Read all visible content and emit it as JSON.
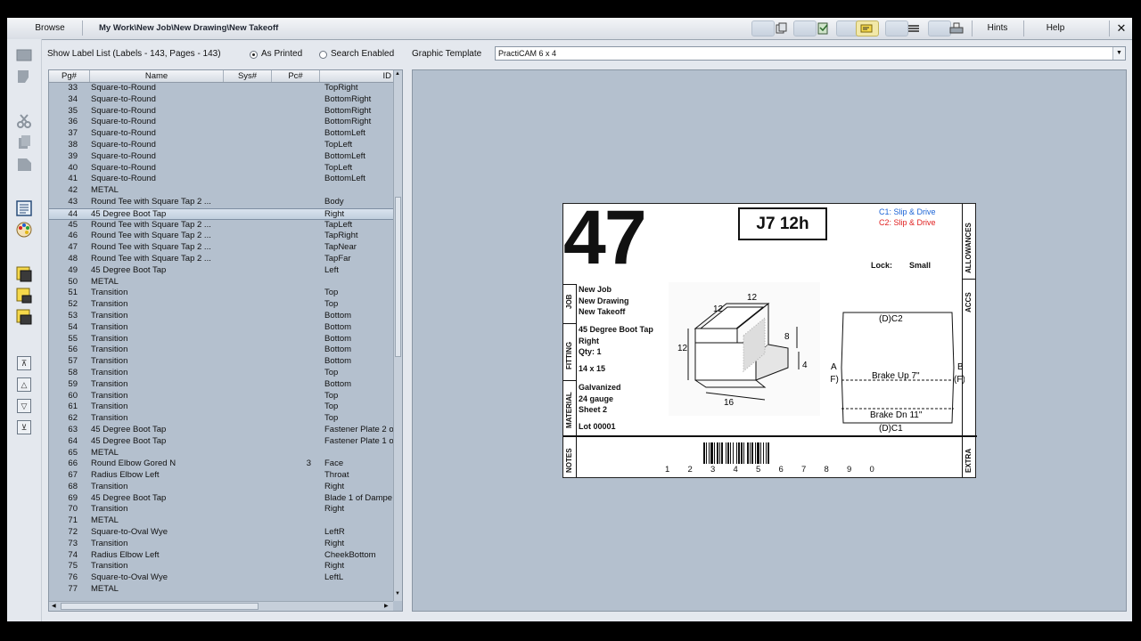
{
  "topbar": {
    "browse": "Browse",
    "path": "My Work\\New Job\\New Drawing\\New Takeoff",
    "hints": "Hints",
    "help": "Help",
    "close": "✕"
  },
  "controls": {
    "show_label_list": "Show Label List (Labels - 143, Pages - 143)",
    "as_printed": "As Printed",
    "search_enabled": "Search Enabled",
    "graphic_template_label": "Graphic Template",
    "graphic_template_value": "PractiCAM 6 x 4"
  },
  "list": {
    "columns": [
      "Pg#",
      "Name",
      "Sys#",
      "Pc#",
      "ID"
    ],
    "selected_pg": "44",
    "rows": [
      {
        "pg": "33",
        "name": "Square-to-Round",
        "pc": "",
        "id": "TopRight"
      },
      {
        "pg": "34",
        "name": "Square-to-Round",
        "pc": "",
        "id": "BottomRight"
      },
      {
        "pg": "35",
        "name": "Square-to-Round",
        "pc": "",
        "id": "BottomRight"
      },
      {
        "pg": "36",
        "name": "Square-to-Round",
        "pc": "",
        "id": "BottomRight"
      },
      {
        "pg": "37",
        "name": "Square-to-Round",
        "pc": "",
        "id": "BottomLeft"
      },
      {
        "pg": "38",
        "name": "Square-to-Round",
        "pc": "",
        "id": "TopLeft"
      },
      {
        "pg": "39",
        "name": "Square-to-Round",
        "pc": "",
        "id": "BottomLeft"
      },
      {
        "pg": "40",
        "name": "Square-to-Round",
        "pc": "",
        "id": "TopLeft"
      },
      {
        "pg": "41",
        "name": "Square-to-Round",
        "pc": "",
        "id": "BottomLeft"
      },
      {
        "pg": "42",
        "name": "METAL",
        "pc": "",
        "id": ""
      },
      {
        "pg": "43",
        "name": "Round Tee with Square Tap 2 ...",
        "pc": "",
        "id": "Body"
      },
      {
        "pg": "44",
        "name": "45 Degree Boot Tap",
        "pc": "",
        "id": "Right"
      },
      {
        "pg": "45",
        "name": "Round Tee with Square Tap 2 ...",
        "pc": "",
        "id": "TapLeft"
      },
      {
        "pg": "46",
        "name": "Round Tee with Square Tap 2 ...",
        "pc": "",
        "id": "TapRight"
      },
      {
        "pg": "47",
        "name": "Round Tee with Square Tap 2 ...",
        "pc": "",
        "id": "TapNear"
      },
      {
        "pg": "48",
        "name": "Round Tee with Square Tap 2 ...",
        "pc": "",
        "id": "TapFar"
      },
      {
        "pg": "49",
        "name": "45 Degree Boot Tap",
        "pc": "",
        "id": "Left"
      },
      {
        "pg": "50",
        "name": "METAL",
        "pc": "",
        "id": ""
      },
      {
        "pg": "51",
        "name": "Transition",
        "pc": "",
        "id": "Top"
      },
      {
        "pg": "52",
        "name": "Transition",
        "pc": "",
        "id": "Top"
      },
      {
        "pg": "53",
        "name": "Transition",
        "pc": "",
        "id": "Bottom"
      },
      {
        "pg": "54",
        "name": "Transition",
        "pc": "",
        "id": "Bottom"
      },
      {
        "pg": "55",
        "name": "Transition",
        "pc": "",
        "id": "Bottom"
      },
      {
        "pg": "56",
        "name": "Transition",
        "pc": "",
        "id": "Bottom"
      },
      {
        "pg": "57",
        "name": "Transition",
        "pc": "",
        "id": "Bottom"
      },
      {
        "pg": "58",
        "name": "Transition",
        "pc": "",
        "id": "Top"
      },
      {
        "pg": "59",
        "name": "Transition",
        "pc": "",
        "id": "Bottom"
      },
      {
        "pg": "60",
        "name": "Transition",
        "pc": "",
        "id": "Top"
      },
      {
        "pg": "61",
        "name": "Transition",
        "pc": "",
        "id": "Top"
      },
      {
        "pg": "62",
        "name": "Transition",
        "pc": "",
        "id": "Top"
      },
      {
        "pg": "63",
        "name": "45 Degree Boot Tap",
        "pc": "",
        "id": "Fastener Plate 2 o"
      },
      {
        "pg": "64",
        "name": "45 Degree Boot Tap",
        "pc": "",
        "id": "Fastener Plate 1 o"
      },
      {
        "pg": "65",
        "name": "METAL",
        "pc": "",
        "id": ""
      },
      {
        "pg": "66",
        "name": "Round Elbow Gored N",
        "pc": "3",
        "id": "Face"
      },
      {
        "pg": "67",
        "name": "Radius Elbow Left",
        "pc": "",
        "id": "Throat"
      },
      {
        "pg": "68",
        "name": "Transition",
        "pc": "",
        "id": "Right"
      },
      {
        "pg": "69",
        "name": "45 Degree Boot Tap",
        "pc": "",
        "id": "Blade 1 of Dampe"
      },
      {
        "pg": "70",
        "name": "Transition",
        "pc": "",
        "id": "Right"
      },
      {
        "pg": "71",
        "name": "METAL",
        "pc": "",
        "id": ""
      },
      {
        "pg": "72",
        "name": "Square-to-Oval Wye",
        "pc": "",
        "id": "LeftR"
      },
      {
        "pg": "73",
        "name": "Transition",
        "pc": "",
        "id": "Right"
      },
      {
        "pg": "74",
        "name": "Radius Elbow Left",
        "pc": "",
        "id": "CheekBottom"
      },
      {
        "pg": "75",
        "name": "Transition",
        "pc": "",
        "id": "Right"
      },
      {
        "pg": "76",
        "name": "Square-to-Oval Wye",
        "pc": "",
        "id": "LeftL"
      },
      {
        "pg": "77",
        "name": "METAL",
        "pc": "",
        "id": ""
      }
    ]
  },
  "label": {
    "number": "47",
    "code": "J7  12h",
    "c1": "C1: Slip & Drive",
    "c2": "C2: Slip & Drive",
    "c1_color": "#1a63d6",
    "c2_color": "#e02020",
    "lock_label": "Lock:",
    "lock_value": "Small",
    "tab_job": "JOB",
    "tab_fitting": "FITTING",
    "tab_material": "MATERIAL",
    "tab_notes": "NOTES",
    "tab_allowances": "ALLOWANCES",
    "tab_accs": "ACCS",
    "tab_extra": "EXTRA",
    "job": [
      "New Job",
      "New Drawing",
      "New Takeoff"
    ],
    "fitting": [
      "45 Degree Boot Tap",
      "Right",
      "Qty: 1",
      "",
      "14 x 15"
    ],
    "material": [
      "Galvanized",
      "24 gauge",
      "Sheet 2",
      "",
      "Lot 00001"
    ],
    "dim_top": "12",
    "dim_top2": "12",
    "dim_left": "12",
    "dim_right": "8",
    "dim_right2": "4",
    "dim_bottom": "16",
    "flat_top": "(D)C2",
    "flat_bottom": "(D)C1",
    "brake_up": "Brake Up 7\"",
    "brake_dn": "Brake Dn 11\"",
    "side_a": "A",
    "side_a_f": "(F)",
    "side_b": "B",
    "side_b_f": "(F)",
    "barcode_digits": [
      "1",
      "2",
      "3",
      "4",
      "5",
      "6",
      "7",
      "8",
      "9",
      "0"
    ]
  }
}
